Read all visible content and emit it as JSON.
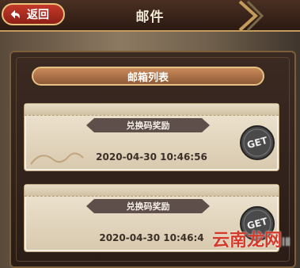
{
  "header": {
    "back_label": "返回",
    "title": "邮件"
  },
  "mailbox": {
    "section_title": "邮箱列表",
    "items": [
      {
        "title": "兑换码奖励",
        "date": "2020-04-30 10:46:56",
        "badge": "GET"
      },
      {
        "title": "兑换码奖励",
        "date": "2020-04-30 10:46:4",
        "badge": "GET"
      }
    ]
  },
  "watermark": {
    "text": "云南龙网",
    "suffix": "ⅠⅡ"
  },
  "colors": {
    "accent_red": "#c43a2a",
    "gold_border": "#e6c186",
    "card_bg": "#efe5d2",
    "banner": "#5f4f4b"
  }
}
